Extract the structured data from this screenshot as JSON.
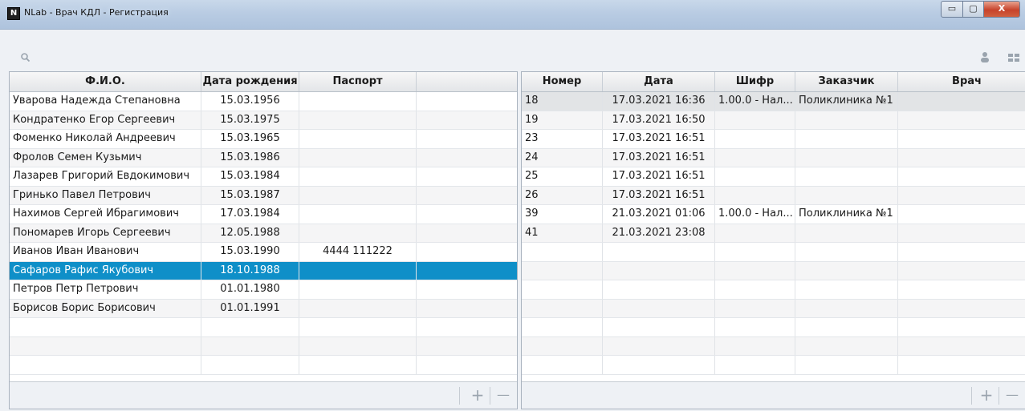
{
  "window": {
    "title": "NLab - Врач КДЛ - Регистрация",
    "app_icon_letter": "N",
    "min_glyph": "▭",
    "max_glyph": "▢",
    "close_glyph": "X"
  },
  "toolbar": {
    "search_icon": "search-icon",
    "user_icon": "user-icon",
    "grid_icon": "grid-icon"
  },
  "patients": {
    "columns": [
      "Ф.И.О.",
      "Дата рождения",
      "Паспорт",
      ""
    ],
    "rows": [
      {
        "name": "Уварова Надежда Степановна",
        "dob": "15.03.1956",
        "passport": ""
      },
      {
        "name": "Кондратенко Егор Сергеевич",
        "dob": "15.03.1975",
        "passport": ""
      },
      {
        "name": "Фоменко Николай Андреевич",
        "dob": "15.03.1965",
        "passport": ""
      },
      {
        "name": "Фролов Семен Кузьмич",
        "dob": "15.03.1986",
        "passport": ""
      },
      {
        "name": "Лазарев Григорий Евдокимович",
        "dob": "15.03.1984",
        "passport": ""
      },
      {
        "name": "Гринько Павел Петрович",
        "dob": "15.03.1987",
        "passport": ""
      },
      {
        "name": "Нахимов Сергей Ибрагимович",
        "dob": "17.03.1984",
        "passport": ""
      },
      {
        "name": "Пономарев Игорь Сергеевич",
        "dob": "12.05.1988",
        "passport": ""
      },
      {
        "name": "Иванов Иван Иванович",
        "dob": "15.03.1990",
        "passport": "4444 111222"
      },
      {
        "name": "Сафаров Рафис Якубович",
        "dob": "18.10.1988",
        "passport": ""
      },
      {
        "name": "Петров Петр Петрович",
        "dob": "01.01.1980",
        "passport": ""
      },
      {
        "name": "Борисов Борис Борисович",
        "dob": "01.01.1991",
        "passport": ""
      }
    ],
    "selected_index": 9,
    "add_label": "+",
    "remove_label": "—"
  },
  "orders": {
    "columns": [
      "Номер",
      "Дата",
      "Шифр",
      "Заказчик",
      "Врач"
    ],
    "rows": [
      {
        "num": "18",
        "date": "17.03.2021 16:36",
        "code": "1.00.0 - Нал...",
        "customer": "Поликлиника №1",
        "doctor": ""
      },
      {
        "num": "19",
        "date": "17.03.2021 16:50",
        "code": "",
        "customer": "",
        "doctor": ""
      },
      {
        "num": "23",
        "date": "17.03.2021 16:51",
        "code": "",
        "customer": "",
        "doctor": ""
      },
      {
        "num": "24",
        "date": "17.03.2021 16:51",
        "code": "",
        "customer": "",
        "doctor": ""
      },
      {
        "num": "25",
        "date": "17.03.2021 16:51",
        "code": "",
        "customer": "",
        "doctor": ""
      },
      {
        "num": "26",
        "date": "17.03.2021 16:51",
        "code": "",
        "customer": "",
        "doctor": ""
      },
      {
        "num": "39",
        "date": "21.03.2021 01:06",
        "code": "1.00.0 - Нал...",
        "customer": "Поликлиника №1",
        "doctor": ""
      },
      {
        "num": "41",
        "date": "21.03.2021 23:08",
        "code": "",
        "customer": "",
        "doctor": ""
      }
    ],
    "highlighted_index": 0,
    "add_label": "+",
    "remove_label": "—"
  },
  "colors": {
    "selection": "#0f8fc8",
    "highlight": "#e2e4e6",
    "title_bar": "#b9cce3"
  }
}
